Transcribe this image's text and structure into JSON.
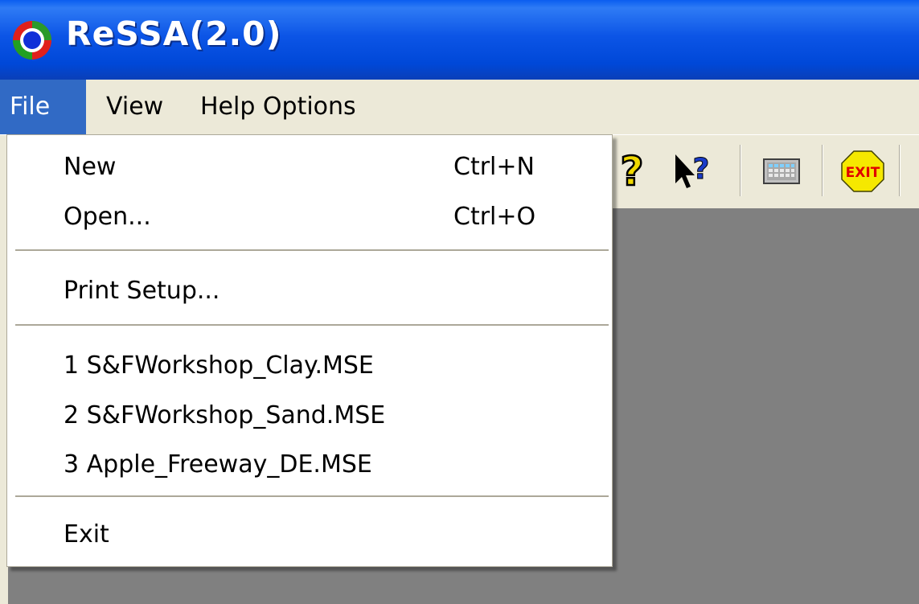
{
  "window": {
    "title": "ReSSA(2.0)"
  },
  "menubar": {
    "items": [
      {
        "label": "File",
        "active": true
      },
      {
        "label": "View",
        "active": false
      },
      {
        "label": "Help Options",
        "active": false
      }
    ]
  },
  "file_menu": {
    "items": [
      {
        "label": "New",
        "shortcut": "Ctrl+N"
      },
      {
        "label": "Open...",
        "shortcut": "Ctrl+O"
      },
      {
        "label": "Print Setup...",
        "shortcut": ""
      },
      {
        "label": "1 S&FWorkshop_Clay.MSE",
        "shortcut": ""
      },
      {
        "label": "2 S&FWorkshop_Sand.MSE",
        "shortcut": ""
      },
      {
        "label": "3 Apple_Freeway_DE.MSE",
        "shortcut": ""
      },
      {
        "label": "Exit",
        "shortcut": ""
      }
    ]
  },
  "toolbar": {
    "icons": [
      "help-question-icon",
      "context-help-icon",
      "calculator-icon",
      "exit-sign-icon"
    ],
    "exit_icon_label": "EXIT"
  },
  "colors": {
    "titlebar": "#0054e3",
    "menu_highlight": "#316ac5",
    "workspace": "#808080",
    "chrome": "#ece9d8"
  }
}
